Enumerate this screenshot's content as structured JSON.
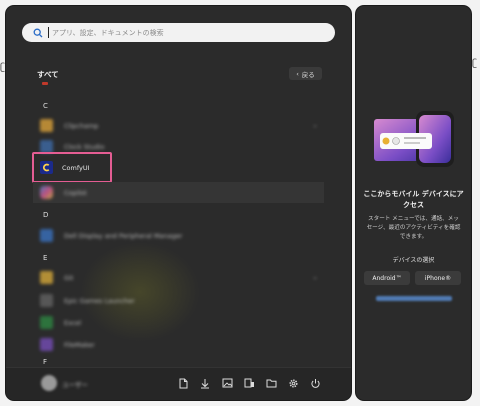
{
  "search": {
    "placeholder": "アプリ、設定、ドキュメントの検索"
  },
  "section": {
    "title": "すべて",
    "back_label": "戻る"
  },
  "list": {
    "letters": [
      "C",
      "D",
      "E",
      "F"
    ],
    "items": [
      {
        "name": "Clipchamp",
        "icon_color": "#e6a93a",
        "blurred": true,
        "has_chevron": true
      },
      {
        "name": "Clock Studio",
        "icon_color": "#3f6fb0",
        "blurred": true,
        "has_chevron": false
      },
      {
        "name": "ComfyUI",
        "icon_color": "#1b2a8a",
        "blurred": false,
        "has_chevron": false
      },
      {
        "name": "Copilot",
        "icon_color": "#5c8ee6",
        "blurred": true,
        "has_chevron": false
      },
      {
        "name": "Dell Display and Peripheral Manager",
        "icon_color": "#3a76c9",
        "blurred": true,
        "has_chevron": false
      },
      {
        "name": "Git",
        "icon_color": "#e0b03a",
        "blurred": true,
        "has_chevron": true
      },
      {
        "name": "Epic Games Launcher",
        "icon_color": "#666666",
        "blurred": true,
        "has_chevron": false
      },
      {
        "name": "Excel",
        "icon_color": "#2e8b43",
        "blurred": true,
        "has_chevron": false
      },
      {
        "name": "FileMaker",
        "icon_color": "#7a4fc0",
        "blurred": true,
        "has_chevron": false
      }
    ]
  },
  "footer": {
    "user_name": "ユーザー"
  },
  "phone_panel": {
    "title": "ここからモバイル デバイスにアクセス",
    "description": "スタート メニューでは、通話、メッセージ、最近のアクティビティを確認できます。",
    "device_label": "デバイスの選択",
    "android_label": "Android™",
    "iphone_label": "iPhone®"
  },
  "colors": {
    "highlight": "#e45d93",
    "panel_bg": "#2b2b2b",
    "accent_link": "#5a8fd6"
  }
}
